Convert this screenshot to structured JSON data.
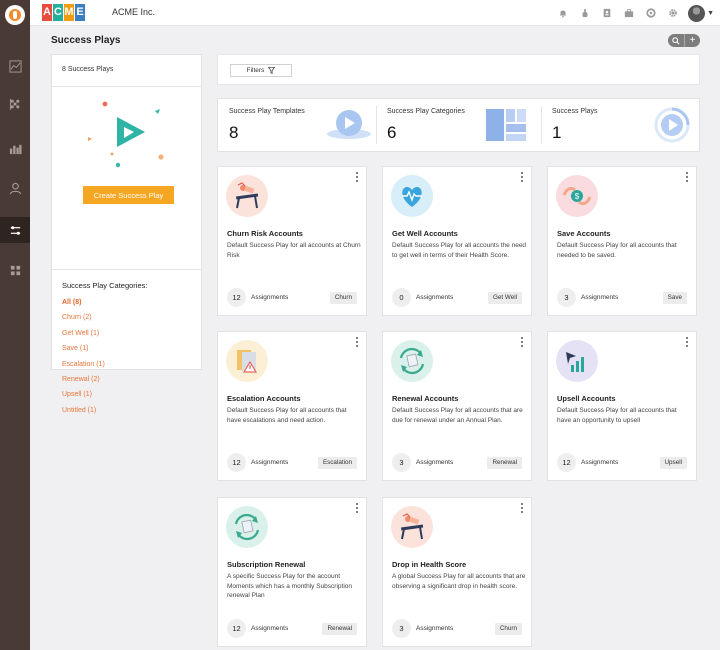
{
  "topbar": {
    "brand_letters": [
      {
        "ch": "A",
        "color": "#e84c3d"
      },
      {
        "ch": "C",
        "color": "#27ae9a"
      },
      {
        "ch": "M",
        "color": "#f39c12"
      },
      {
        "ch": "E",
        "color": "#3a7fc1"
      }
    ],
    "company": "ACME Inc.",
    "icons": [
      "bell-icon",
      "hand-pointer-icon",
      "contact-card-icon",
      "briefcase-icon",
      "lifebuoy-icon",
      "gear-icon"
    ]
  },
  "page": {
    "title": "Success Plays",
    "search_icon": "search-icon",
    "add_label": "+"
  },
  "left_panel": {
    "count_label": "8 Success Plays",
    "create_button": "Create Success Play",
    "categories_title": "Success Play Categories:",
    "categories": [
      "All (8)",
      "Churn (2)",
      "Get Well (1)",
      "Save (1)",
      "Escalation (1)",
      "Renewal (2)",
      "Upsell (1)",
      "Untitled (1)"
    ]
  },
  "filters": {
    "label": "Filters"
  },
  "stats": [
    {
      "label": "Success Play Templates",
      "value": "8"
    },
    {
      "label": "Success Play Categories",
      "value": "6"
    },
    {
      "label": "Success Plays",
      "value": "1"
    }
  ],
  "cards": [
    {
      "title": "Churn Risk Accounts",
      "desc": "Default Success Play for all accounts at Churn Risk",
      "count": "12",
      "assign_label": "Assignments",
      "tag": "Churn",
      "icon": "churn-risk-icon"
    },
    {
      "title": "Get Well Accounts",
      "desc": "Default Success Play for all accounts the need to get well in terms of their Health Score.",
      "count": "0",
      "assign_label": "Assignments",
      "tag": "Get Well",
      "icon": "heartbeat-icon"
    },
    {
      "title": "Save Accounts",
      "desc": "Default Success Play for all accounts that needed to be saved.",
      "count": "3",
      "assign_label": "Assignments",
      "tag": "Save",
      "icon": "money-hands-icon"
    },
    {
      "title": "Escalation Accounts",
      "desc": "Default Success Play for all accounts that have escalations and need action.",
      "count": "12",
      "assign_label": "Assignments",
      "tag": "Escalation",
      "icon": "warning-folder-icon"
    },
    {
      "title": "Renewal Accounts",
      "desc": "Default Success Play for all accounts that are due for renewal under an Annual Plan.",
      "count": "3",
      "assign_label": "Assignments",
      "tag": "Renewal",
      "icon": "renewal-icon"
    },
    {
      "title": "Upsell Accounts",
      "desc": "Default Success Play for all accounts that have an opportunity to upsell",
      "count": "12",
      "assign_label": "Assignments",
      "tag": "Upsell",
      "icon": "growth-chart-icon"
    },
    {
      "title": "Subscription Renewal",
      "desc": "A specific Success Play for the account Moments which has a monthly Subscription renewal Plan",
      "count": "12",
      "assign_label": "Assignments",
      "tag": "Renewal",
      "icon": "renewal-icon"
    },
    {
      "title": "Drop in Health Score",
      "desc": "A global Success Play for all accounts that are observing a significant drop in health score.",
      "count": "3",
      "assign_label": "Assignments",
      "tag": "Churn",
      "icon": "churn-risk-icon"
    }
  ]
}
